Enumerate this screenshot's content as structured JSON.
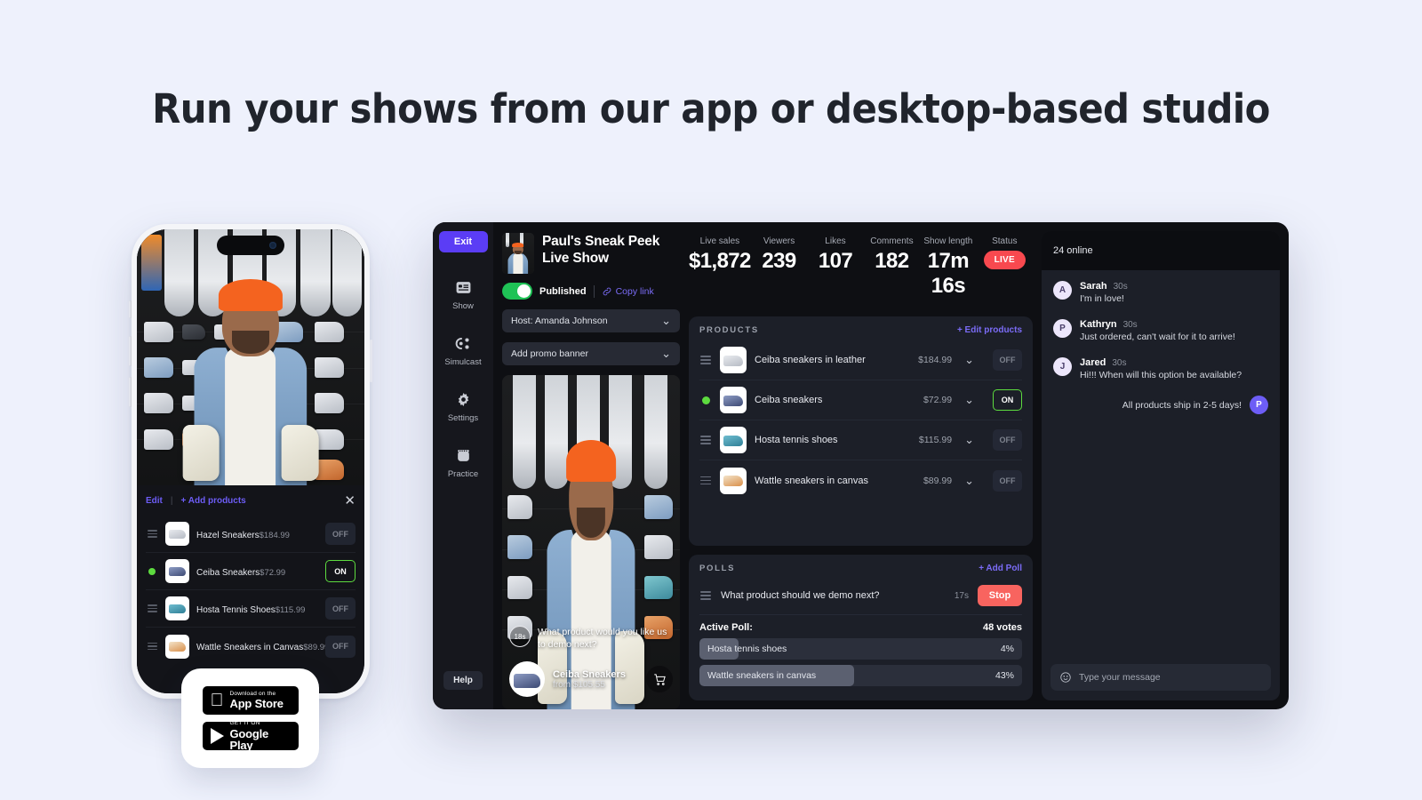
{
  "headline": "Run your shows from our app or desktop-based studio",
  "phone": {
    "list_header": {
      "edit": "Edit",
      "separator": "|",
      "add": "+ Add products",
      "close_icon": "close-icon"
    },
    "products": [
      {
        "name": "Hazel Sneakers",
        "price": "$184.99",
        "toggle": "OFF",
        "active": false,
        "thumb": "white"
      },
      {
        "name": "Ceiba Sneakers",
        "price": "$72.99",
        "toggle": "ON",
        "active": true,
        "thumb": "navy"
      },
      {
        "name": "Hosta Tennis Shoes",
        "price": "$115.99",
        "toggle": "OFF",
        "active": false,
        "thumb": "teal"
      },
      {
        "name": "Wattle Sneakers in Canvas",
        "price": "$89.99",
        "toggle": "OFF",
        "active": false,
        "thumb": "cream"
      }
    ]
  },
  "store_badges": [
    {
      "small": "Download on the",
      "large": "App Store",
      "icon": "apple-icon"
    },
    {
      "small": "GET IT ON",
      "large": "Google Play",
      "icon": "google-play-icon"
    }
  ],
  "studio": {
    "exit_label": "Exit",
    "nav": [
      {
        "label": "Show",
        "icon": "show-icon"
      },
      {
        "label": "Simulcast",
        "icon": "simulcast-icon"
      },
      {
        "label": "Settings",
        "icon": "gear-icon"
      },
      {
        "label": "Practice",
        "icon": "practice-icon"
      }
    ],
    "help_label": "Help",
    "show_title": "Paul's Sneak Peek Live Show",
    "published_label": "Published",
    "published_on": true,
    "copy_link_label": "Copy  link",
    "host_select": "Host: Amanda Johnson",
    "promo_select": "Add promo banner",
    "overlay": {
      "timer": "18s",
      "question": "What product would you like us to demo next?",
      "product_name": "Ceiba Sneakers",
      "product_from": "from $105.55",
      "cart_icon": "cart-icon"
    },
    "stats": [
      {
        "label": "Live sales",
        "value": "$1,872"
      },
      {
        "label": "Viewers",
        "value": "239"
      },
      {
        "label": "Likes",
        "value": "107"
      },
      {
        "label": "Comments",
        "value": "182"
      },
      {
        "label": "Show length",
        "value": "17m 16s"
      }
    ],
    "status": {
      "label": "Status",
      "badge": "LIVE"
    },
    "products_panel": {
      "title": "PRODUCTS",
      "action": "+ Edit products",
      "rows": [
        {
          "name": "Ceiba sneakers in leather",
          "price": "$184.99",
          "toggle": "OFF",
          "active": false,
          "thumb": "white"
        },
        {
          "name": "Ceiba sneakers",
          "price": "$72.99",
          "toggle": "ON",
          "active": true,
          "thumb": "navy"
        },
        {
          "name": "Hosta tennis shoes",
          "price": "$115.99",
          "toggle": "OFF",
          "active": false,
          "thumb": "teal"
        },
        {
          "name": "Wattle sneakers in canvas",
          "price": "$89.99",
          "toggle": "OFF",
          "active": false,
          "thumb": "cream"
        }
      ]
    },
    "polls_panel": {
      "title": "POLLS",
      "action": "+ Add Poll",
      "question": "What product should we demo next?",
      "timer": "17s",
      "stop_label": "Stop",
      "active_label": "Active Poll:",
      "votes": "48 votes",
      "options": [
        {
          "label": "Hosta tennis shoes",
          "pct_label": "4%",
          "fill": 12
        },
        {
          "label": "Wattle sneakers in canvas",
          "pct_label": "43%",
          "fill": 48
        }
      ]
    },
    "chat": {
      "online": "24 online",
      "messages": [
        {
          "initial": "A",
          "name": "Sarah",
          "time": "30s",
          "text": "I'm in love!",
          "own": false
        },
        {
          "initial": "P",
          "name": "Kathryn",
          "time": "30s",
          "text": "Just ordered, can't wait for it to arrive!",
          "own": false
        },
        {
          "initial": "J",
          "name": "Jared",
          "time": "30s",
          "text": "Hi!!! When will this option be available?",
          "own": false
        },
        {
          "initial": "P",
          "name": "",
          "time": "",
          "text": "All products ship in 2-5 days!",
          "own": true
        }
      ],
      "input_placeholder": "Type your message",
      "emoji_icon": "smiley-icon"
    }
  },
  "colors": {
    "accent": "#6d5df6",
    "live": "#f8494f",
    "green": "#5ddb3f",
    "page_bg": "#eef1fc"
  }
}
